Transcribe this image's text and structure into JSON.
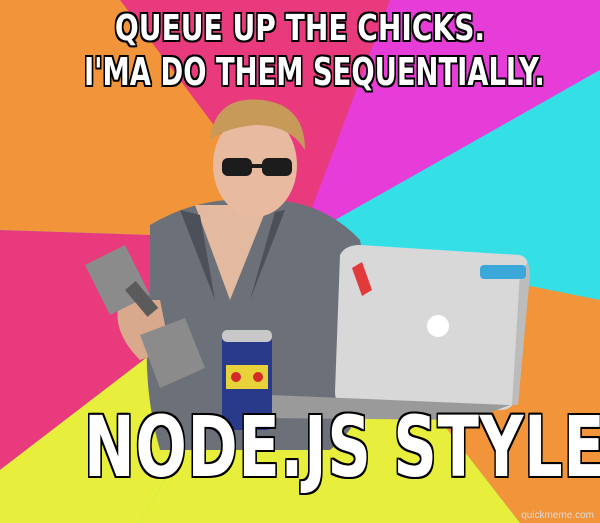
{
  "meme": {
    "top_line_1": "QUEUE UP THE CHICKS.",
    "top_line_2": "I'MA DO THEM SEQUENTIALLY.",
    "bottom_text": "NODE.JS STYLE",
    "watermark": "quickmeme.com"
  },
  "colors": {
    "orange": "#f2943a",
    "pink": "#ea3a7e",
    "magenta": "#e63cd8",
    "cyan": "#35dfe6",
    "yellow": "#e7ee3c",
    "text": "#ffffff",
    "outline": "#000000"
  }
}
